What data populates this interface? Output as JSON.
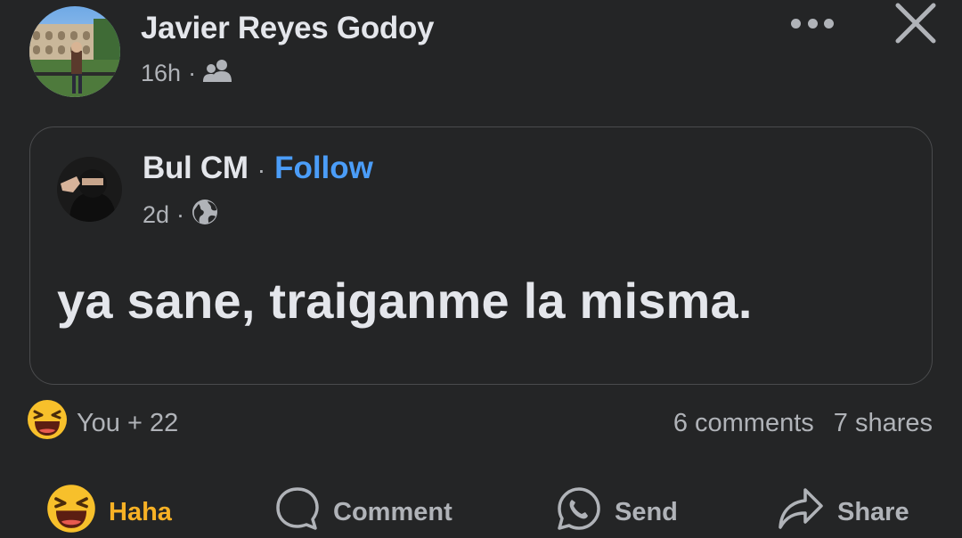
{
  "post": {
    "author": "Javier Reyes Godoy",
    "time": "16h",
    "separator": "·",
    "audience_icon": "friends-icon"
  },
  "shared": {
    "author": "Bul CM",
    "separator": "·",
    "follow_label": "Follow",
    "time": "2d",
    "audience_icon": "globe-icon",
    "text": "ya sane, traiganme la misma."
  },
  "reactions": {
    "icon": "haha-emoji-icon",
    "summary": "You + 22",
    "comments": "6 comments",
    "shares": "7 shares"
  },
  "actions": {
    "haha_label": "Haha",
    "comment_label": "Comment",
    "send_label": "Send",
    "share_label": "Share"
  },
  "colors": {
    "background": "#242526",
    "link": "#4b9df8",
    "reaction_active": "#f7b125",
    "secondary_text": "#b0b3b8"
  }
}
